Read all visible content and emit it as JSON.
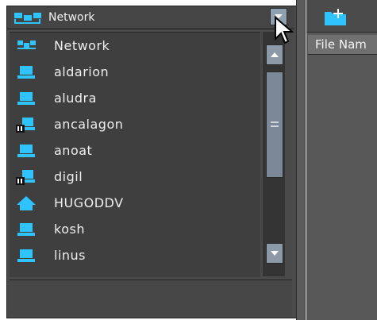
{
  "location_combo": {
    "value": "Network",
    "icon": "network-icon"
  },
  "network_list": {
    "items": [
      {
        "label": "Network",
        "icon": "network-icon"
      },
      {
        "label": "aldarion",
        "icon": "computer-icon"
      },
      {
        "label": "aludra",
        "icon": "computer-icon"
      },
      {
        "label": "ancalagon",
        "icon": "server-icon"
      },
      {
        "label": "anoat",
        "icon": "computer-icon"
      },
      {
        "label": "digil",
        "icon": "server-icon"
      },
      {
        "label": "HUGODDV",
        "icon": "home-icon"
      },
      {
        "label": "kosh",
        "icon": "computer-icon"
      },
      {
        "label": "linus",
        "icon": "computer-icon"
      }
    ]
  },
  "right_pane": {
    "column_header": "File Nam",
    "toolbar_button_icon": "new-folder-icon"
  },
  "colors": {
    "accent_cyan": "#2fc3ff",
    "pane_bg": "#4a4a4a",
    "list_bg": "#3f3f3f",
    "scrollbar": "#8c9aa8"
  }
}
